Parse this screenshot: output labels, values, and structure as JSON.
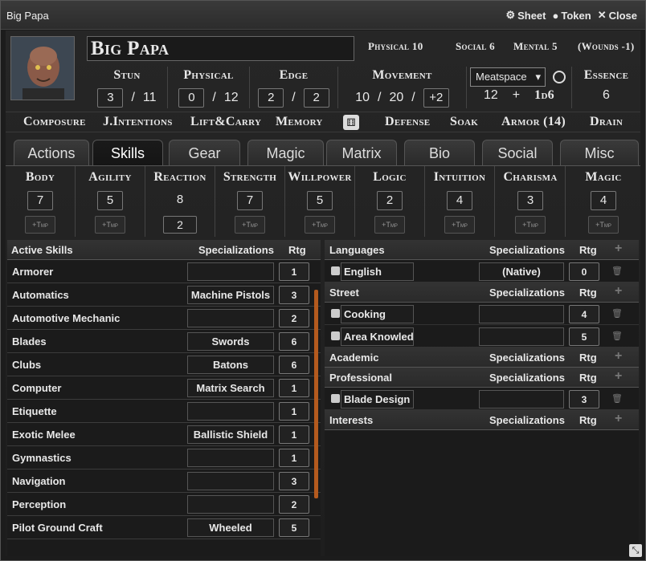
{
  "window": {
    "title": "Big Papa",
    "sheet_label": "Sheet",
    "token_label": "Token",
    "close_label": "Close"
  },
  "character": {
    "name": "Big Papa"
  },
  "limits": {
    "physical": "Physical 10",
    "social": "Social 6",
    "mental": "Mental 5",
    "wounds": "(Wounds -1)"
  },
  "condition": {
    "stun_label": "Stun",
    "stun_value": "3",
    "stun_sep": "/",
    "stun_max": "11",
    "physical_label": "Physical",
    "physical_value": "0",
    "physical_sep": "/",
    "physical_max": "12",
    "edge_label": "Edge",
    "edge_value": "2",
    "edge_sep": "/",
    "edge_max": "2",
    "movement_label": "Movement",
    "walk": "10",
    "mv_sep1": "/",
    "run": "20",
    "mv_sep2": "/",
    "sprint": "+2",
    "initiative_mode": "Meatspace",
    "init_base": "12",
    "init_plus": "+",
    "init_dice": "1d6",
    "essence_label": "Essence",
    "essence_value": "6"
  },
  "derived": {
    "composure": "Composure",
    "judge_intentions": "J.Intentions",
    "lift_carry": "Lift&Carry",
    "memory": "Memory",
    "defense": "Defense",
    "soak": "Soak",
    "armor": "Armor (14)",
    "drain": "Drain"
  },
  "tabs": [
    "Actions",
    "Skills",
    "Gear",
    "Magic",
    "Matrix",
    "Bio",
    "Social",
    "Misc"
  ],
  "tmp_label": "+Tmp",
  "attributes": [
    {
      "name": "Body",
      "value": "7"
    },
    {
      "name": "Agility",
      "value": "5"
    },
    {
      "name": "Reaction",
      "value": "8",
      "aug": "2"
    },
    {
      "name": "Strength",
      "value": "7"
    },
    {
      "name": "Willpower",
      "value": "5"
    },
    {
      "name": "Logic",
      "value": "2"
    },
    {
      "name": "Intuition",
      "value": "4"
    },
    {
      "name": "Charisma",
      "value": "3"
    },
    {
      "name": "Magic",
      "value": "4"
    }
  ],
  "active_skills": {
    "header": "Active Skills",
    "spec_header": "Specializations",
    "rtg_header": "Rtg",
    "rows": [
      {
        "name": "Armorer",
        "spec": "",
        "rtg": "1"
      },
      {
        "name": "Automatics",
        "spec": "Machine Pistols",
        "rtg": "3"
      },
      {
        "name": "Automotive Mechanic",
        "spec": "",
        "rtg": "2"
      },
      {
        "name": "Blades",
        "spec": "Swords",
        "rtg": "6"
      },
      {
        "name": "Clubs",
        "spec": "Batons",
        "rtg": "6"
      },
      {
        "name": "Computer",
        "spec": "Matrix Search",
        "rtg": "1"
      },
      {
        "name": "Etiquette",
        "spec": "",
        "rtg": "1"
      },
      {
        "name": "Exotic Melee",
        "spec": "Ballistic Shield",
        "rtg": "1"
      },
      {
        "name": "Gymnastics",
        "spec": "",
        "rtg": "1"
      },
      {
        "name": "Navigation",
        "spec": "",
        "rtg": "3"
      },
      {
        "name": "Perception",
        "spec": "",
        "rtg": "2"
      },
      {
        "name": "Pilot Ground Craft",
        "spec": "Wheeled",
        "rtg": "5"
      }
    ]
  },
  "knowledge": {
    "spec_header": "Specializations",
    "rtg_header": "Rtg",
    "plus": "+",
    "groups": [
      {
        "title": "Languages",
        "rows": [
          {
            "name": "English",
            "spec": "(Native)",
            "rtg": "0"
          }
        ]
      },
      {
        "title": "Street",
        "rows": [
          {
            "name": "Cooking",
            "spec": "",
            "rtg": "4"
          },
          {
            "name": "Area Knowledg",
            "spec": "",
            "rtg": "5"
          }
        ]
      },
      {
        "title": "Academic",
        "rows": []
      },
      {
        "title": "Professional",
        "rows": [
          {
            "name": "Blade Design",
            "spec": "",
            "rtg": "3"
          }
        ]
      },
      {
        "title": "Interests",
        "rows": []
      }
    ]
  },
  "colors": {
    "accent_scrollbar": "#b45a1e",
    "background": "#1c1c1c"
  }
}
